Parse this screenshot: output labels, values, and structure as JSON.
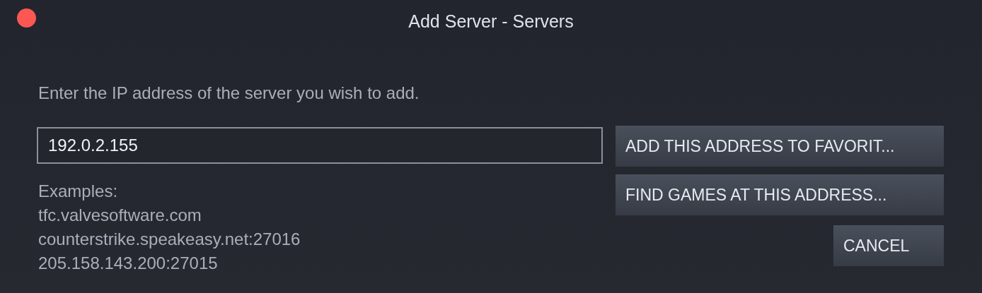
{
  "window": {
    "title": "Add Server - Servers"
  },
  "prompt": "Enter the IP address of the server you wish to add.",
  "address_field": {
    "value": "192.0.2.155"
  },
  "examples": [
    "Examples:",
    "tfc.valvesoftware.com",
    "counterstrike.speakeasy.net:27016",
    "205.158.143.200:27015"
  ],
  "buttons": [
    {
      "label": "ADD THIS ADDRESS TO FAVORIT...",
      "kind": "wide"
    },
    {
      "label": "FIND GAMES AT THIS ADDRESS...",
      "kind": "wide"
    },
    {
      "label": "CANCEL",
      "kind": "small"
    }
  ]
}
